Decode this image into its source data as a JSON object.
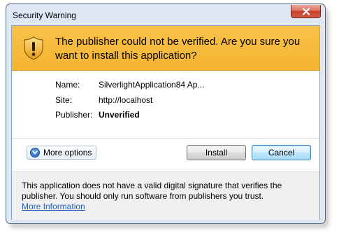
{
  "window": {
    "title": "Security Warning"
  },
  "banner": {
    "icon": "warning-shield-icon",
    "message": "The publisher could not be verified. Are you sure you want to install this application?"
  },
  "details": {
    "name_label": "Name:",
    "name_value": "SilverlightApplication84 Ap...",
    "site_label": "Site:",
    "site_value": "http://localhost",
    "publisher_label": "Publisher:",
    "publisher_value": "Unverified"
  },
  "actions": {
    "more_options_label": "More options",
    "install_label": "Install",
    "cancel_label": "Cancel"
  },
  "footer": {
    "text": "This application does not have a valid digital signature that verifies the publisher. You should only run software from publishers you trust.",
    "link": "More Information"
  },
  "colors": {
    "banner": "#f5b430",
    "link": "#1e5eb8",
    "close_button": "#c7402c"
  }
}
